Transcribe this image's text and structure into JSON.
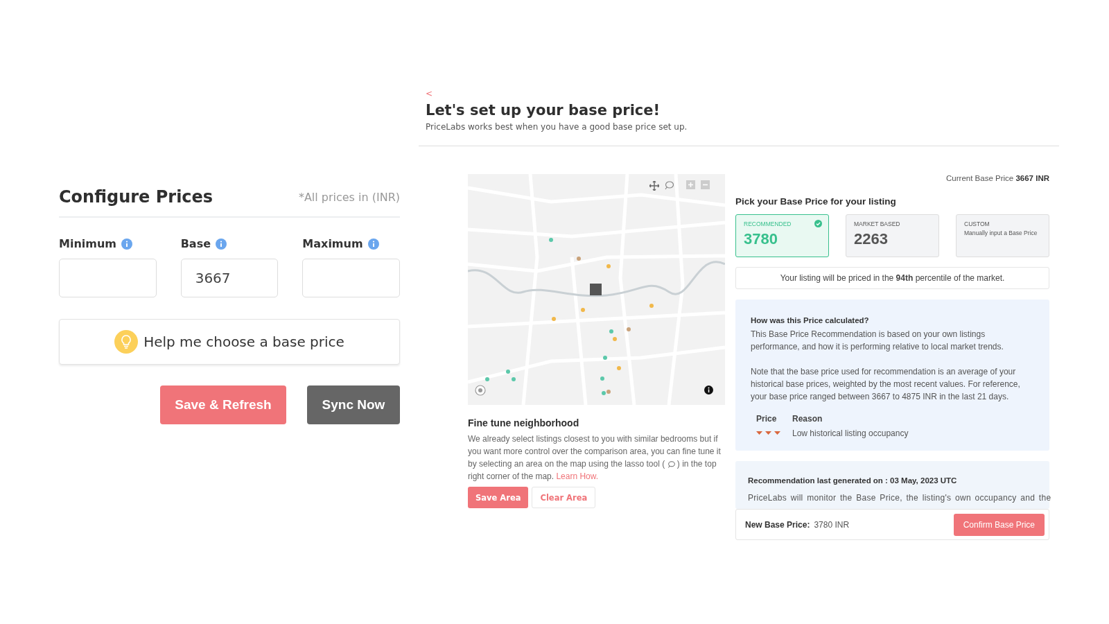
{
  "back": "<",
  "title": "Let's set up your base price!",
  "subtitle": "PriceLabs works best when you have a good base price set up.",
  "configure": {
    "title": "Configure Prices",
    "note": "*All prices in (INR)",
    "fields": [
      {
        "label": "Minimum"
      },
      {
        "label": "Base",
        "value": "3667"
      },
      {
        "label": "Maximum"
      }
    ],
    "help_button": "Help me choose a base price",
    "buttons": [
      {
        "label": "Save & Refresh",
        "kind": "primary"
      },
      {
        "label": "Sync Now",
        "kind": "secondary"
      }
    ]
  },
  "neighborhood": {
    "title": "Fine tune neighborhood",
    "text": "We already select listings closest to you with similar bedrooms but if you want more control over the comparison area, you can fine tune it by selecting an area on the map using the lasso tool (",
    "text_after": ") in the top right corner of the map.",
    "link": "Learn How.",
    "buttons": [
      {
        "label": "Save Area",
        "kind": "primary"
      },
      {
        "label": "Clear Area",
        "kind": "outline"
      }
    ]
  },
  "current_base_price": {
    "label": "Current Base Price",
    "value": "3667 INR"
  },
  "pick_title": "Pick your Base Price for your listing",
  "options": [
    {
      "label": "RECOMMENDED",
      "value": "3780",
      "selected": true
    },
    {
      "label": "MARKET BASED",
      "value": "2263",
      "selected": false
    },
    {
      "label": "CUSTOM",
      "description": "Manually input a Base Price",
      "selected": false
    }
  ],
  "percentile_text": "Your listing will be priced in the **94th** percentile of the market.",
  "calculation": {
    "title": "How was this Price calculated?",
    "paragraphs": [
      "This Base Price Recommendation is based on your own listings performance, and how it is performing relative to local market trends.",
      "Note that the base price used for recommendation is an average of your historical base prices, weighted by the most recent values. For reference, your base price ranged between 3667 to 4875 INR in the last 21 days."
    ],
    "columns": [
      "Price",
      "Reason"
    ],
    "reasons": [
      {
        "reason": "Low historical listing occupancy"
      }
    ]
  },
  "recommendation": {
    "title": "Recommendation last generated on : 03 May, 2023 UTC",
    "text": "PriceLabs will monitor the Base Price, the listing's own occupancy and the"
  },
  "footer": {
    "label": "New Base Price:",
    "value": "3780 INR",
    "button": "Confirm Base Price"
  }
}
